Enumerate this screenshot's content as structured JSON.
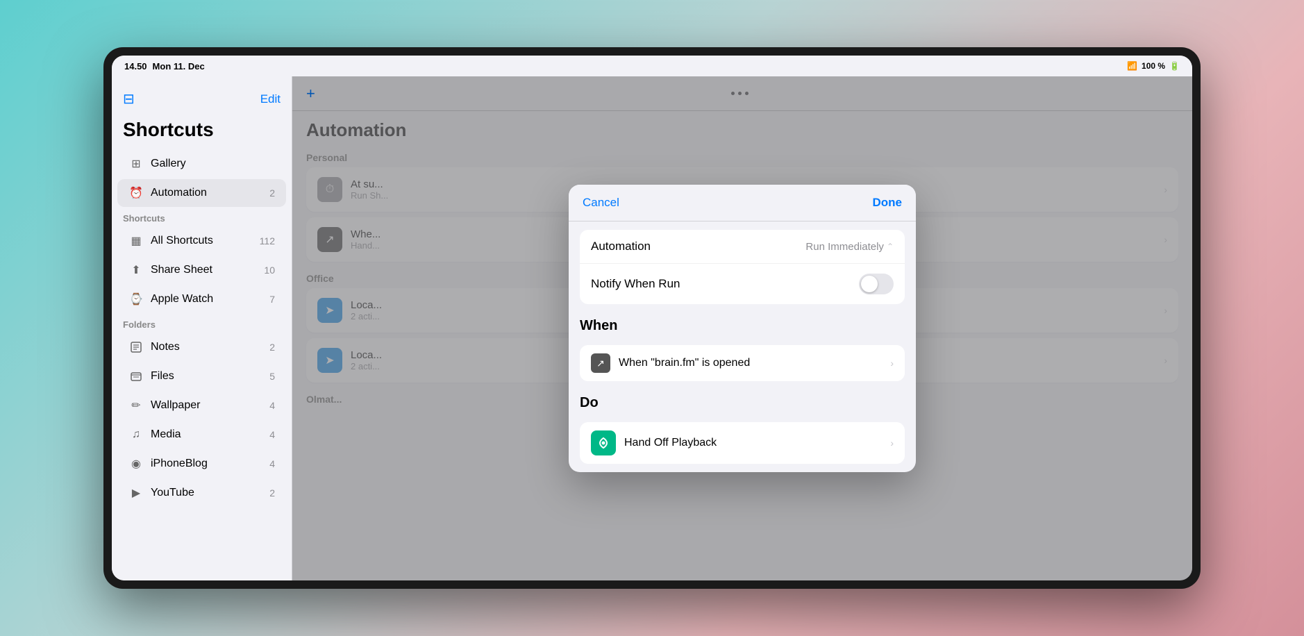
{
  "statusBar": {
    "time": "14.50",
    "date": "Mon 11. Dec",
    "wifi": "wifi",
    "battery": "100 %",
    "charging": true
  },
  "sidebar": {
    "title": "Shortcuts",
    "editLabel": "Edit",
    "sections": [
      {
        "items": [
          {
            "id": "gallery",
            "icon": "⊞",
            "label": "Gallery",
            "badge": ""
          },
          {
            "id": "automation",
            "icon": "⏰",
            "label": "Automation",
            "badge": "2",
            "active": true
          }
        ]
      }
    ],
    "shortcutsLabel": "Shortcuts",
    "shortcuts": [
      {
        "id": "all-shortcuts",
        "icon": "▦",
        "label": "All Shortcuts",
        "badge": "112"
      },
      {
        "id": "share-sheet",
        "icon": "⬆",
        "label": "Share Sheet",
        "badge": "10"
      },
      {
        "id": "apple-watch",
        "icon": "⌚",
        "label": "Apple Watch",
        "badge": "7"
      }
    ],
    "foldersLabel": "Folders",
    "folders": [
      {
        "id": "notes",
        "icon": "♪",
        "label": "Notes",
        "badge": "2"
      },
      {
        "id": "files",
        "icon": "▦",
        "label": "Files",
        "badge": "5"
      },
      {
        "id": "wallpaper",
        "icon": "✏",
        "label": "Wallpaper",
        "badge": "4"
      },
      {
        "id": "media",
        "icon": "♫",
        "label": "Media",
        "badge": "4"
      },
      {
        "id": "iphoneblog",
        "icon": "◉",
        "label": "iPhoneBlog",
        "badge": "4"
      },
      {
        "id": "youtube",
        "icon": "▶",
        "label": "YouTube",
        "badge": "2"
      }
    ]
  },
  "content": {
    "plusLabel": "+",
    "title": "Automation",
    "sectionPersonal": "Personal",
    "items": [
      {
        "id": "at-sunrise",
        "iconType": "gray",
        "iconChar": "⏱",
        "title": "At su...",
        "subtitle": "Run Sh..."
      },
      {
        "id": "when-hand-off",
        "iconType": "dark",
        "iconChar": "↗",
        "title": "Whe...",
        "subtitle": "Hand..."
      },
      {
        "id": "loca-1",
        "iconType": "blue",
        "iconChar": "➤",
        "title": "Loca...",
        "subtitle": "2 acti..."
      },
      {
        "id": "loca-2",
        "iconType": "blue",
        "iconChar": "➤",
        "title": "Loca...",
        "subtitle": "2 acti..."
      }
    ],
    "sectionOffice": "Office",
    "sectionOlmats": "Olmat..."
  },
  "modal": {
    "cancelLabel": "Cancel",
    "doneLabel": "Done",
    "automationLabel": "Automation",
    "automationValue": "Run Immediately",
    "notifyLabel": "Notify When Run",
    "whenSectionTitle": "When",
    "whenItem": {
      "icon": "↗",
      "label": "When \"brain.fm\" is opened"
    },
    "doSectionTitle": "Do",
    "doItem": {
      "iconBg": "#00b887",
      "iconChar": "⬡",
      "label": "Hand Off Playback"
    }
  }
}
